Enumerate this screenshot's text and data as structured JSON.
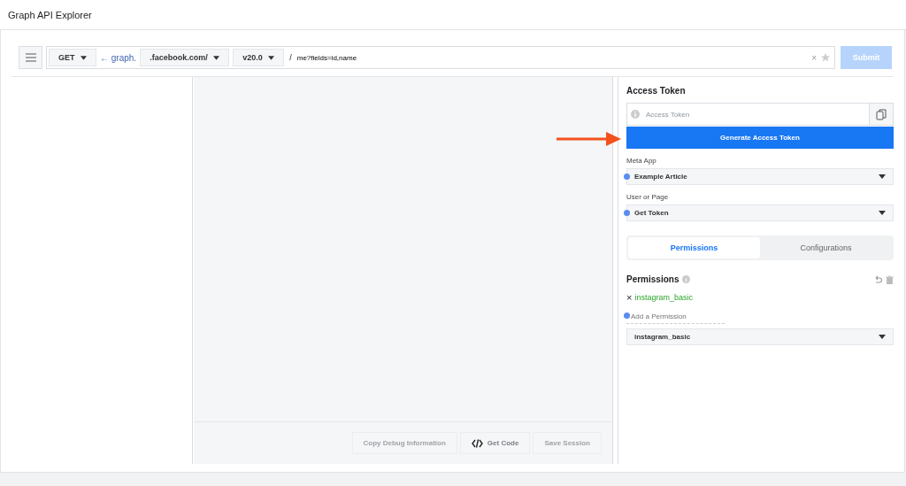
{
  "window": {
    "title": "Graph API Explorer"
  },
  "toolbar": {
    "method": "GET",
    "prefix": "← graph.",
    "domain": ".facebook.com/",
    "version": "v20.0",
    "separator": "/",
    "path": "me?fields=id,name",
    "clear": "×",
    "submit": {
      "label": "Submit",
      "disabled": true
    }
  },
  "footer_buttons": [
    {
      "kind": "plain",
      "label": "Copy Debug Information",
      "disabled": true
    },
    {
      "kind": "code",
      "label": "Get Code",
      "disabled": false
    },
    {
      "kind": "plain",
      "label": "Save Session",
      "disabled": true
    }
  ],
  "access_token": {
    "heading": "Access Token",
    "placeholder": "Access Token",
    "generate": "Generate Access Token"
  },
  "selects": [
    {
      "label": "Meta App",
      "value": "Example Article"
    },
    {
      "label": "User or Page",
      "value": "Get Token"
    }
  ],
  "tabs": [
    {
      "label": "Permissions",
      "selected": true
    },
    {
      "label": "Configurations",
      "selected": false
    }
  ],
  "permissions": {
    "heading": "Permissions",
    "chips": [
      {
        "remove": "×",
        "name": "instagram_basic"
      }
    ],
    "add_placeholder": "Add a Permission",
    "select_value": "instagram_basic"
  }
}
